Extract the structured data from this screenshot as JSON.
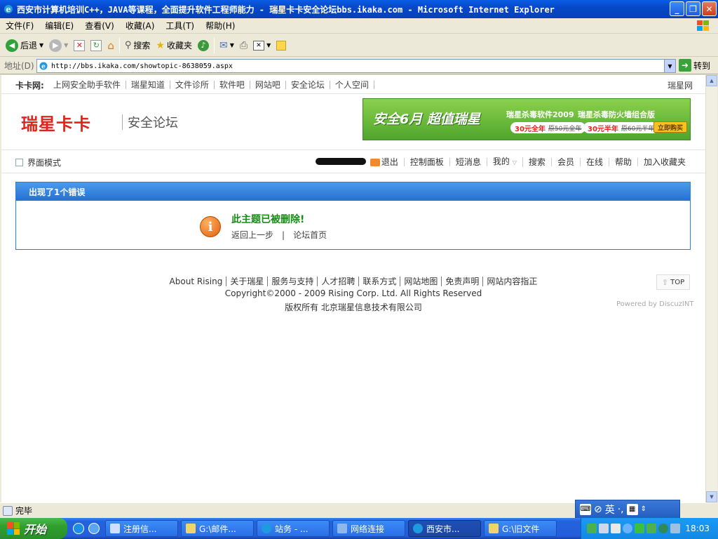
{
  "window": {
    "title": "西安市计算机培训C++，JAVA等课程，全面提升软件工程师能力 - 瑞星卡卡安全论坛bbs.ikaka.com - Microsoft Internet Explorer",
    "buttons": [
      "_",
      "❐",
      "✕"
    ]
  },
  "menubar": {
    "items": [
      "文件(F)",
      "编辑(E)",
      "查看(V)",
      "收藏(A)",
      "工具(T)",
      "帮助(H)"
    ]
  },
  "toolbar": {
    "back": "后退",
    "search": "搜索",
    "favorites": "收藏夹"
  },
  "address": {
    "label": "地址(D)",
    "url": "http://bbs.ikaka.com/showtopic-8638059.aspx",
    "go": "转到"
  },
  "page": {
    "topnav": {
      "brand": "卡卡网:",
      "links": [
        "上网安全助手软件",
        "瑞星知道",
        "文件诊所",
        "软件吧",
        "网站吧",
        "安全论坛",
        "个人空间"
      ],
      "right": "瑞星网"
    },
    "logo": "瑞星卡卡",
    "forum_name": "安全论坛",
    "banner": {
      "headline": "安全6月 超值瑞星",
      "product1": "瑞星杀毒软件2009",
      "product2": "瑞星杀毒防火墙组合版",
      "price1": "30元全年",
      "orig1": "原50元全年",
      "price2": "30元半年",
      "orig2": "原60元半年",
      "buy": "立即购买"
    },
    "userbar": {
      "ui_mode": "界面模式",
      "logout": "退出",
      "links": [
        "控制面板",
        "短消息",
        "我的",
        "搜索",
        "会员",
        "在线",
        "帮助",
        "加入收藏夹"
      ]
    },
    "error": {
      "header": "出现了1个错误",
      "message": "此主题已被删除!",
      "back": "返回上一步",
      "sep": "|",
      "home": "论坛首页"
    },
    "footer": {
      "links": [
        "About Rising",
        "关于瑞星",
        "服务与支持",
        "人才招聘",
        "联系方式",
        "网站地图",
        "免责声明",
        "网站内容指正"
      ],
      "copyright": "Copyright©2000 - 2009 Rising Corp. Ltd.  All Rights Reserved",
      "company": "版权所有 北京瑞星信息技术有限公司",
      "top": "TOP",
      "powered": "Powered by DiscuzINT"
    }
  },
  "statusbar": {
    "text": "完毕"
  },
  "ime": {
    "lang": "英"
  },
  "taskbar": {
    "start": "开始",
    "tasks": [
      "注册信...",
      "G:\\邮件...",
      "站务 - ...",
      "网络连接",
      "西安市...",
      "G:\\旧文件"
    ],
    "clock": "18:03"
  },
  "colors": {
    "accent_blue": "#2f7ed8",
    "brand_red": "#e2231a",
    "success_green": "#178c15"
  }
}
